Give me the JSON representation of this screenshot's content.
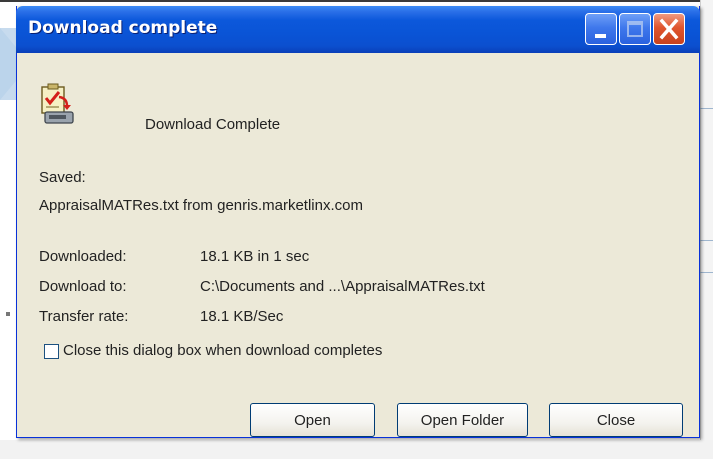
{
  "window": {
    "title": "Download complete",
    "controls": {
      "minimize": "minimize-icon",
      "maximize": "maximize-icon",
      "close": "close-icon"
    }
  },
  "dialog": {
    "heading": "Download Complete",
    "icon": "download-document-icon",
    "saved_label": "Saved:",
    "saved_value": "AppraisalMATRes.txt from genris.marketlinx.com",
    "downloaded_label": "Downloaded:",
    "downloaded_value": "18.1 KB in 1 sec",
    "download_to_label": "Download to:",
    "download_to_value": "C:\\Documents and ...\\AppraisalMATRes.txt",
    "transfer_rate_label": "Transfer rate:",
    "transfer_rate_value": "18.1 KB/Sec",
    "close_when_done": {
      "label": "Close this dialog box when download completes",
      "checked": false
    }
  },
  "buttons": {
    "open": "Open",
    "open_folder": "Open Folder",
    "close": "Close"
  },
  "colors": {
    "titlebar": "#0a54d6",
    "dialog_background": "#ece9d8",
    "close_button": "#e0552e"
  }
}
